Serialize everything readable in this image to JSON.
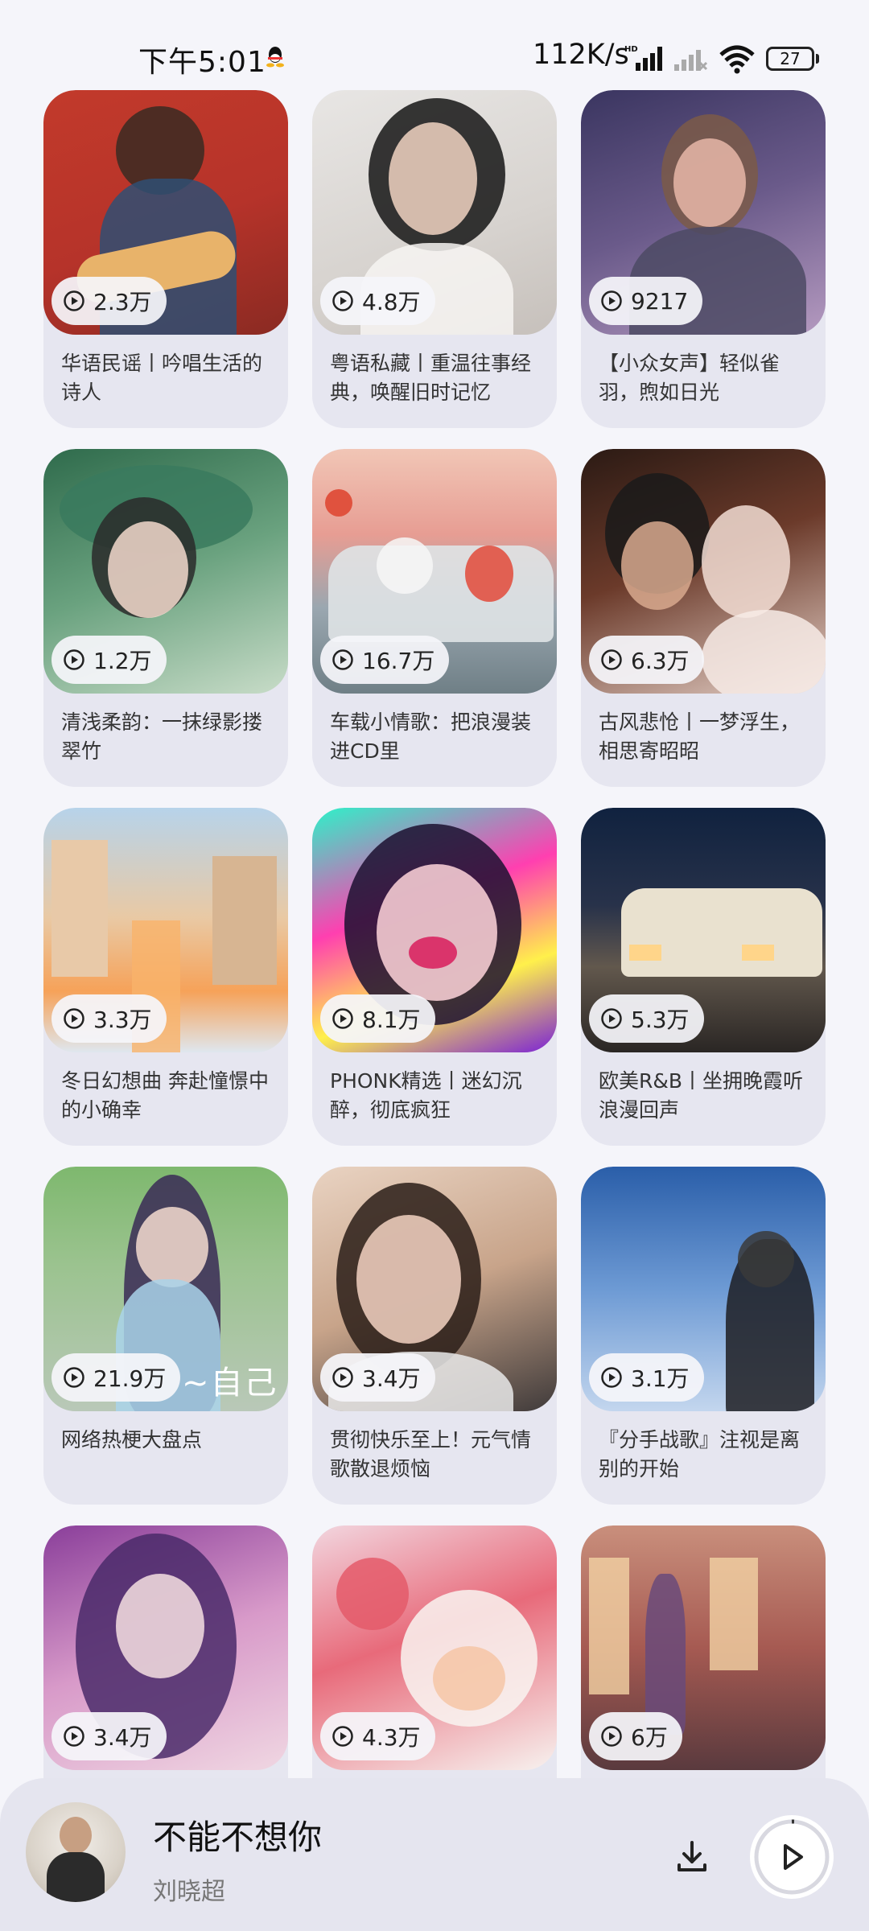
{
  "status": {
    "time": "下午5:01",
    "net_speed": "112K/s",
    "battery": "27"
  },
  "playlists": [
    {
      "count": "2.3万",
      "title": "华语民谣丨吟唱生活的诗人"
    },
    {
      "count": "4.8万",
      "title": "粤语私藏丨重温往事经典，唤醒旧时记忆"
    },
    {
      "count": "9217",
      "title": "【小众女声】轻似雀羽，煦如日光"
    },
    {
      "count": "1.2万",
      "title": "清浅柔韵：一抹绿影搂翠竹"
    },
    {
      "count": "16.7万",
      "title": "车载小情歌：把浪漫装进CD里"
    },
    {
      "count": "6.3万",
      "title": "古风悲怆丨一梦浮生，相思寄昭昭"
    },
    {
      "count": "3.3万",
      "title": "冬日幻想曲 奔赴憧憬中的小确幸"
    },
    {
      "count": "8.1万",
      "title": "PHONK精选丨迷幻沉醉，彻底疯狂"
    },
    {
      "count": "5.3万",
      "title": "欧美R&B丨坐拥晚霞听浪漫回声"
    },
    {
      "count": "21.9万",
      "title": "网络热梗大盘点",
      "cover_text": "~自己~"
    },
    {
      "count": "3.4万",
      "title": "贯彻快乐至上！元气情歌散退烦恼"
    },
    {
      "count": "3.1万",
      "title": "『分手战歌』注视是离别的开始"
    },
    {
      "count": "3.4万",
      "title": ""
    },
    {
      "count": "4.3万",
      "title": ""
    },
    {
      "count": "6万",
      "title": ""
    }
  ],
  "player": {
    "song": "不能不想你",
    "artist": "刘晓超"
  }
}
